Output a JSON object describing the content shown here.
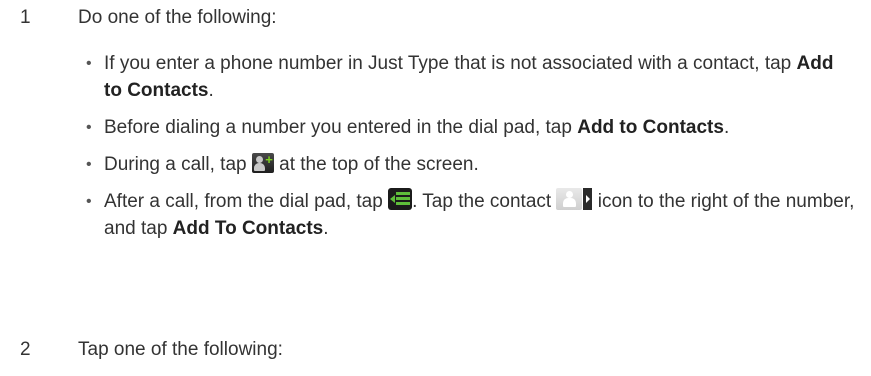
{
  "steps": [
    {
      "number": "1",
      "text": "Do one of the following:"
    },
    {
      "number": "2",
      "text": "Tap one of the following:"
    }
  ],
  "bullets": [
    {
      "before": "If you enter a phone number in Just Type that is not associated with a contact, tap ",
      "bold": "Add to Contacts",
      "after": "."
    },
    {
      "before": "Before dialing a number you entered in the dial pad, tap ",
      "bold": "Add to Contacts",
      "after": "."
    },
    {
      "before": "During a call, tap ",
      "after": " at the top of the screen.",
      "icon": "add-contact-icon"
    },
    {
      "part1": "After a call, from the dial pad, tap ",
      "part2": ". Tap the contact ",
      "part3": " icon to the right of the number, and tap ",
      "bold": "Add To Contacts",
      "after": ".",
      "icons": [
        "menu-icon",
        "contact-icon"
      ]
    }
  ],
  "bullet_glyph": "•"
}
